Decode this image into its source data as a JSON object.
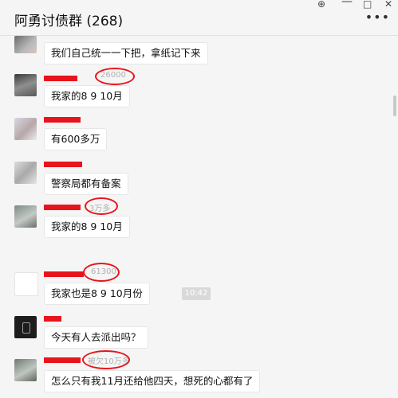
{
  "header": {
    "title": "阿勇讨债群 (268)",
    "pin_icon": "pin-icon",
    "maximize_icon": "maximize-icon",
    "close_icon": "close-icon",
    "more_icon": "more-icon"
  },
  "chat": {
    "timestamp": "10:42",
    "messages": [
      {
        "text": "我们自己统一一下把，拿纸记下来"
      },
      {
        "text": "我家的8 9 10月",
        "note": "26000"
      },
      {
        "text": "有600多万"
      },
      {
        "text": "警察局都有备案"
      },
      {
        "text": "我家的8 9 10月",
        "note": "3万多"
      },
      {
        "text": "我家也是8  9  10月份",
        "note": "61300"
      },
      {
        "text": "今天有人去派出吗？"
      },
      {
        "text": "怎么只有我11月还给他四天，想死的心都有了",
        "note": "被欠10万多"
      }
    ]
  },
  "colors": {
    "redaction": "#e8141c",
    "bubble": "#ffffff",
    "background": "#f5f5f5"
  }
}
